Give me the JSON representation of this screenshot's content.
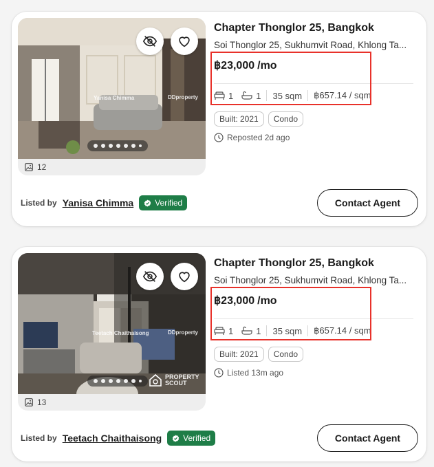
{
  "listings": [
    {
      "title": "Chapter Thonglor 25, Bangkok",
      "address": "Soi Thonglor 25, Sukhumvit Road, Khlong Ta...",
      "price": "฿23,000",
      "price_unit": "/mo",
      "beds": "1",
      "baths": "1",
      "size": "35 sqm",
      "price_per_sqm": "฿657.14 / sqm",
      "tags": [
        "Built: 2021",
        "Condo"
      ],
      "posted": "Reposted 2d ago",
      "photo_count": "12",
      "listed_by_label": "Listed by",
      "agent_name": "Yanisa Chimma",
      "verified_label": "Verified",
      "contact_label": "Contact Agent",
      "watermark_ddproperty": "DDproperty",
      "watermark_agent": "Yanisa Chimma"
    },
    {
      "title": "Chapter Thonglor 25, Bangkok",
      "address": "Soi Thonglor 25, Sukhumvit Road, Khlong Ta...",
      "price": "฿23,000",
      "price_unit": "/mo",
      "beds": "1",
      "baths": "1",
      "size": "35 sqm",
      "price_per_sqm": "฿657.14 / sqm",
      "tags": [
        "Built: 2021",
        "Condo"
      ],
      "posted": "Listed 13m ago",
      "photo_count": "13",
      "listed_by_label": "Listed by",
      "agent_name": "Teetach Chaithaisong",
      "verified_label": "Verified",
      "contact_label": "Contact Agent",
      "watermark_ddproperty": "DDproperty",
      "watermark_agent": "Teetach Chaithaisong",
      "brand_watermark": [
        "PROPERTY",
        "SCOUT"
      ]
    }
  ],
  "colors": {
    "verified_bg": "#1e7d47",
    "highlight_border": "#e8312a"
  },
  "icons": {
    "hide": "eye-off-icon",
    "favorite": "heart-icon",
    "photos": "image-icon",
    "bed": "bed-icon",
    "bath": "bathtub-icon",
    "clock": "clock-icon",
    "verified": "badge-check-icon"
  }
}
